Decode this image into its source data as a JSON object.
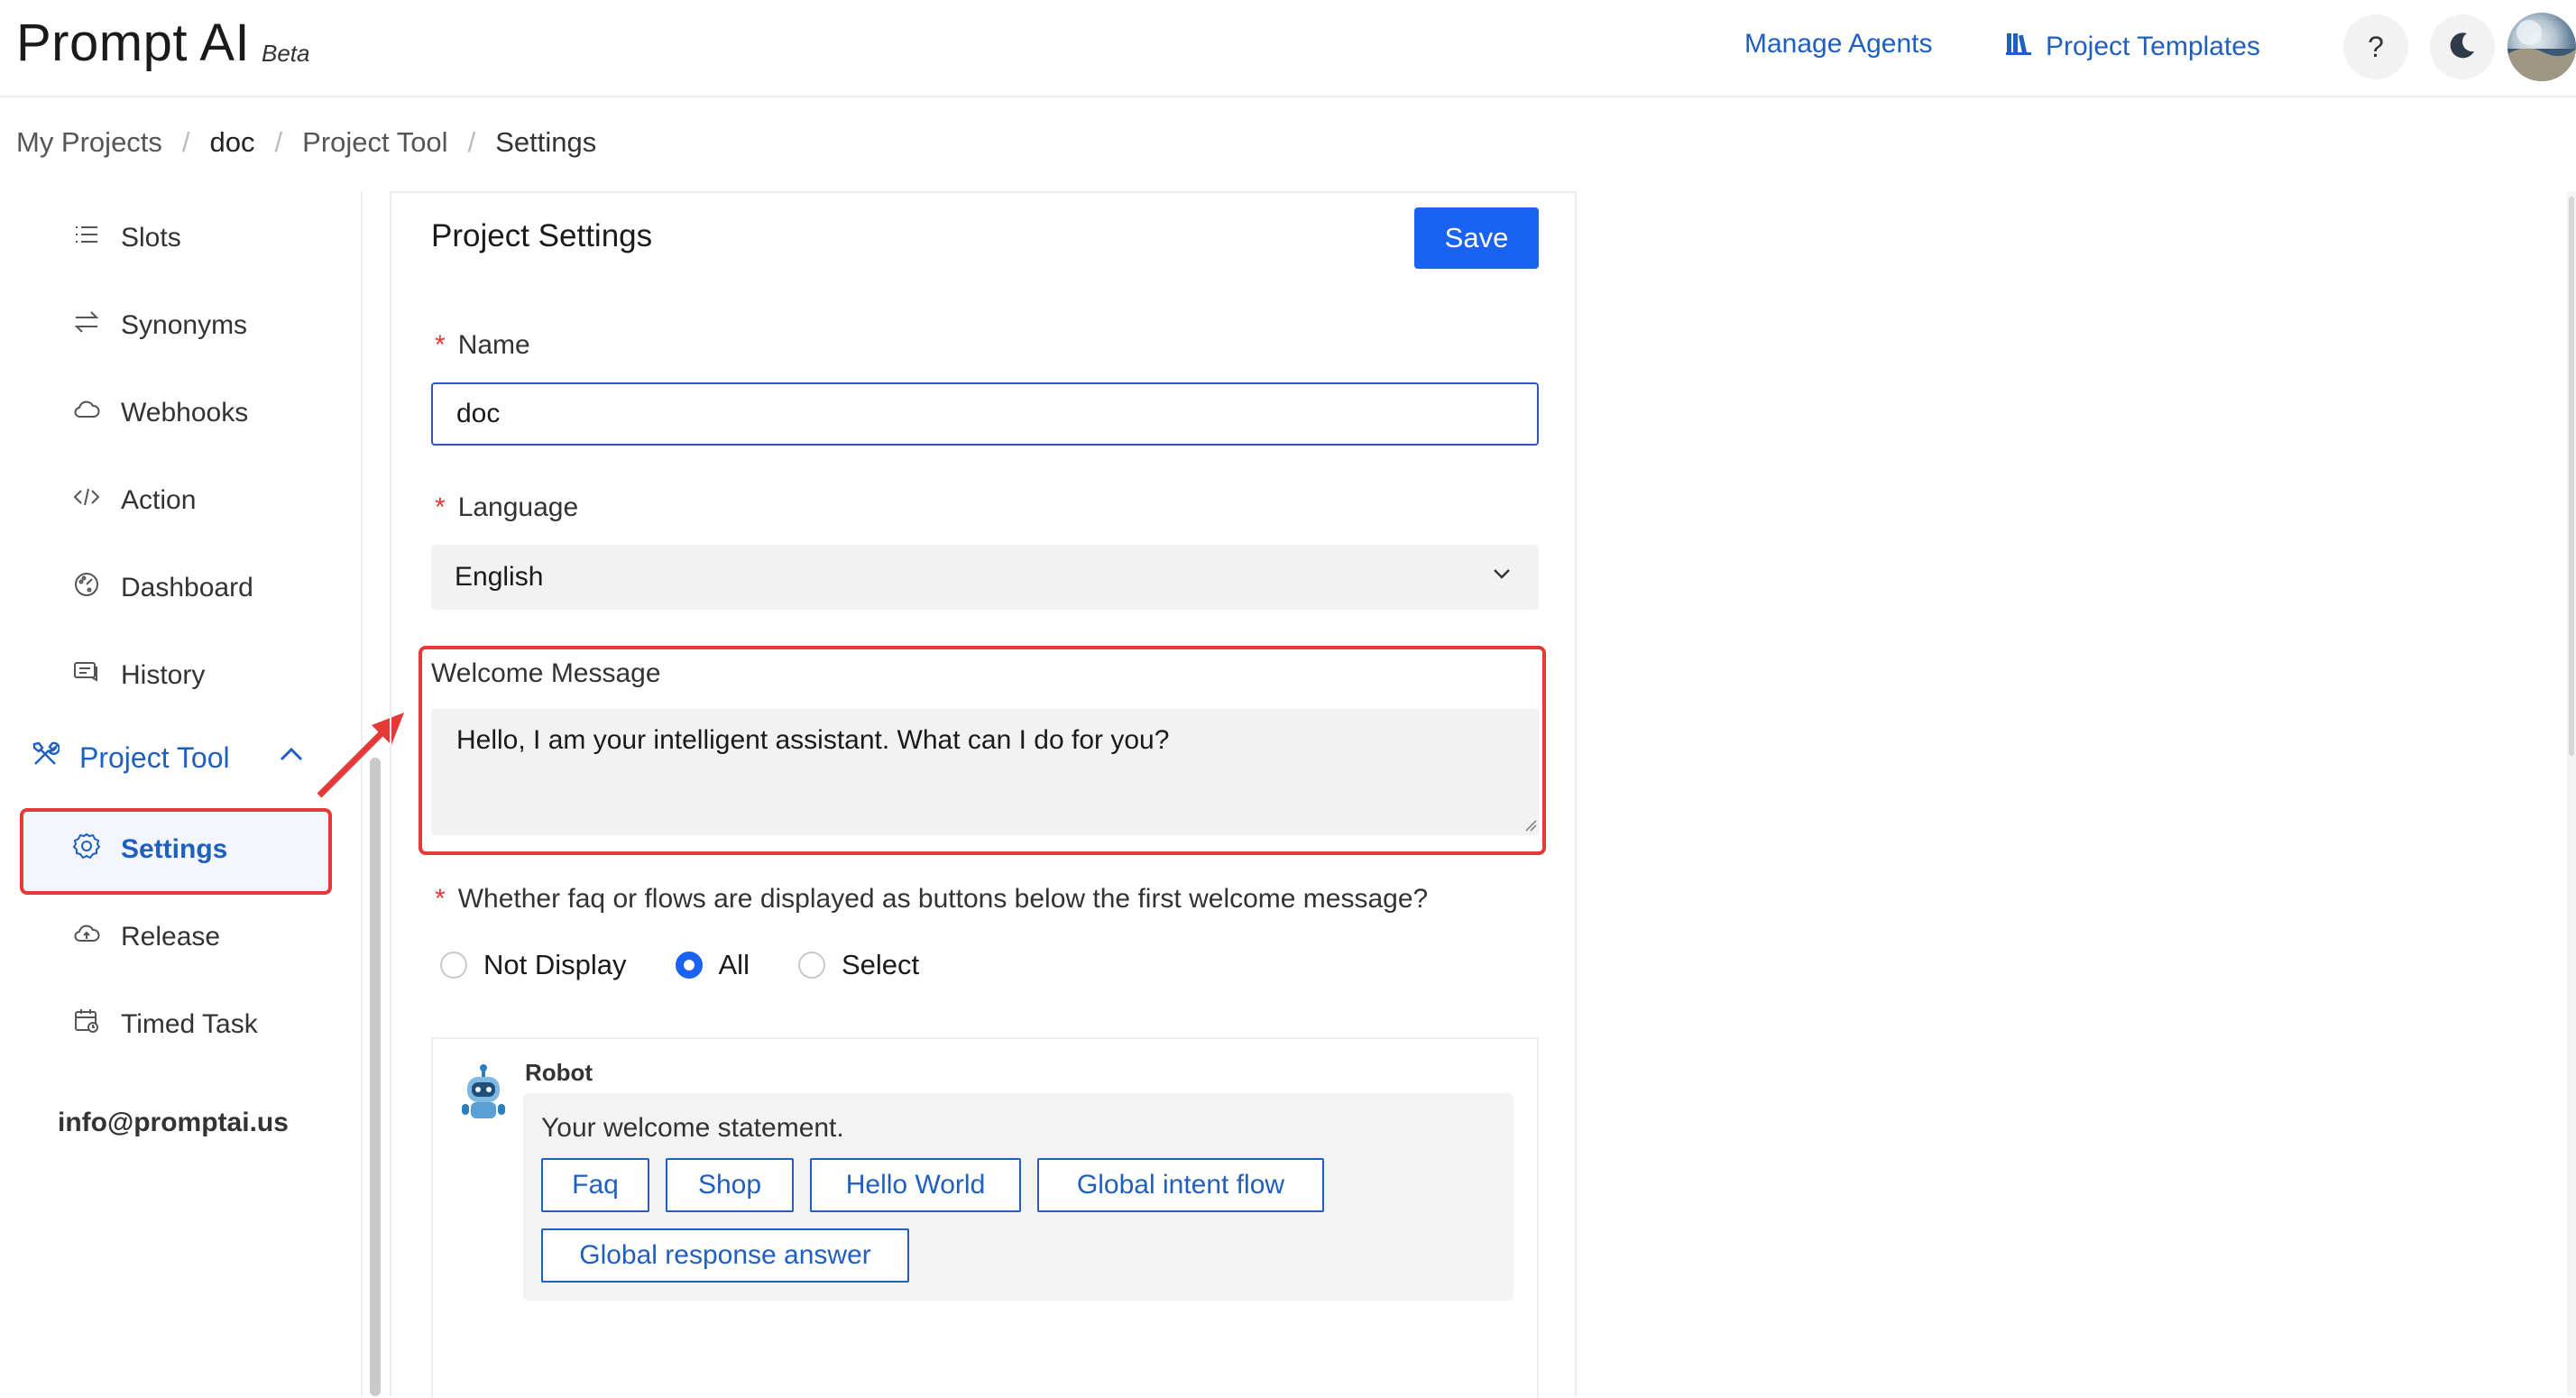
{
  "header": {
    "brand": "Prompt AI",
    "beta": "Beta",
    "manage_agents": "Manage Agents",
    "project_templates": "Project Templates",
    "help": "?"
  },
  "breadcrumb": {
    "items": [
      "My Projects",
      "doc",
      "Project Tool",
      "Settings"
    ],
    "separator": "/"
  },
  "sidebar": {
    "items": [
      {
        "label": "Slots",
        "icon": "list-icon"
      },
      {
        "label": "Synonyms",
        "icon": "swap-icon"
      },
      {
        "label": "Webhooks",
        "icon": "cloud-icon"
      },
      {
        "label": "Action",
        "icon": "code-icon"
      },
      {
        "label": "Dashboard",
        "icon": "dashboard-icon"
      },
      {
        "label": "History",
        "icon": "chat-history-icon"
      }
    ],
    "group": {
      "label": "Project Tool",
      "icon": "tools-icon",
      "expanded": true
    },
    "group_items": [
      {
        "label": "Settings",
        "icon": "gear-icon",
        "active": true
      },
      {
        "label": "Release",
        "icon": "cloud-release-icon"
      },
      {
        "label": "Timed Task",
        "icon": "calendar-icon"
      }
    ],
    "email": "info@promptai.us"
  },
  "card": {
    "title": "Project Settings",
    "save_label": "Save",
    "name_label": "Name",
    "name_value": "doc",
    "language_label": "Language",
    "language_value": "English",
    "welcome_label": "Welcome Message",
    "welcome_value": "Hello, I am your intelligent assistant. What can I do for you?",
    "display_label": "Whether faq or flows are displayed as buttons below the first welcome message?",
    "display_options": [
      {
        "label": "Not Display",
        "selected": false
      },
      {
        "label": "All",
        "selected": true
      },
      {
        "label": "Select",
        "selected": false
      }
    ]
  },
  "preview": {
    "robot_name": "Robot",
    "statement": "Your welcome statement.",
    "buttons": [
      "Faq",
      "Shop",
      "Hello World",
      "Global intent flow",
      "Global response answer"
    ]
  },
  "colors": {
    "accent": "#1a62f2",
    "link": "#1f5fbf",
    "highlight": "#e53935",
    "required": "#e53935"
  }
}
